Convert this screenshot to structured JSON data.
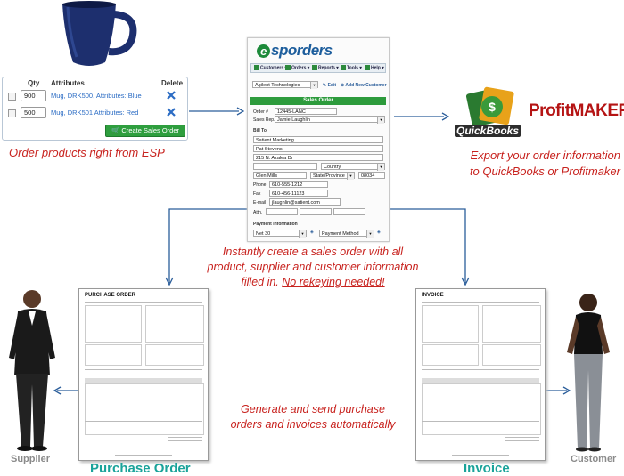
{
  "order_table": {
    "headers": {
      "qty": "Qty",
      "attributes": "Attributes",
      "delete": "Delete"
    },
    "rows": [
      {
        "qty": "900",
        "attributes": "Mug, DRK500, Attributes: Blue"
      },
      {
        "qty": "500",
        "attributes": "Mug, DRK501 Attributes: Red"
      }
    ],
    "create_button": "Create Sales Order"
  },
  "captions": {
    "order_from_esp": "Order products right from ESP",
    "export_line1": "Export your order information",
    "export_line2": "to QuickBooks or Profitmaker",
    "instant_line1": "Instantly create a sales order with all",
    "instant_line2": "product, supplier and customer information",
    "instant_line3": "filled in. ",
    "no_rekeying": "No rekeying needed!",
    "generate_line1": "Generate and send purchase",
    "generate_line2": "orders and invoices automatically"
  },
  "esp": {
    "logo_e": "e",
    "logo_text": "sporders",
    "menu": [
      "Customers",
      "Orders",
      "Reports",
      "Tools",
      "Help"
    ],
    "company": "Agilent Technologies",
    "edit": "Edit",
    "add_customer": "Add New Customer",
    "section_title": "Sales Order",
    "order_label": "Order #",
    "order_no": "12445-LANC",
    "sales_rep_label": "Sales Rep.",
    "sales_rep": "Jamie Laughlin",
    "bill_to": "Bill To",
    "bill_company": "Satient Marketing",
    "bill_name": "Pat Stevens",
    "bill_address": "215 N. Azalea Dr",
    "country_label": "Country",
    "city": "Glen Mills",
    "state_label": "State/Province",
    "zip": "08034",
    "phone_label": "Phone",
    "phone": "610-555-1212",
    "fax_label": "Fax",
    "fax": "610-456-11123",
    "email_label": "E-mail",
    "email": "jlaughlin@satient.com",
    "attn_label": "Attn.",
    "payment_info": "Payment Information",
    "terms": "Net 30",
    "payment_method": "Payment Method"
  },
  "logos": {
    "quickbooks": "QuickBooks",
    "profitmaker": "ProfitMAKER"
  },
  "docs": {
    "purchase_order_title": "PURCHASE ORDER",
    "invoice_title": "INVOICE"
  },
  "labels": {
    "supplier": "Supplier",
    "purchase_order": "Purchase Order",
    "invoice": "Invoice",
    "customer": "Customer"
  },
  "colors": {
    "red": "#c8231f",
    "teal": "#1aa39a",
    "esp_green": "#2d9b3c",
    "esp_blue": "#1c5d9c",
    "arrow_blue": "#2a5d9a"
  }
}
